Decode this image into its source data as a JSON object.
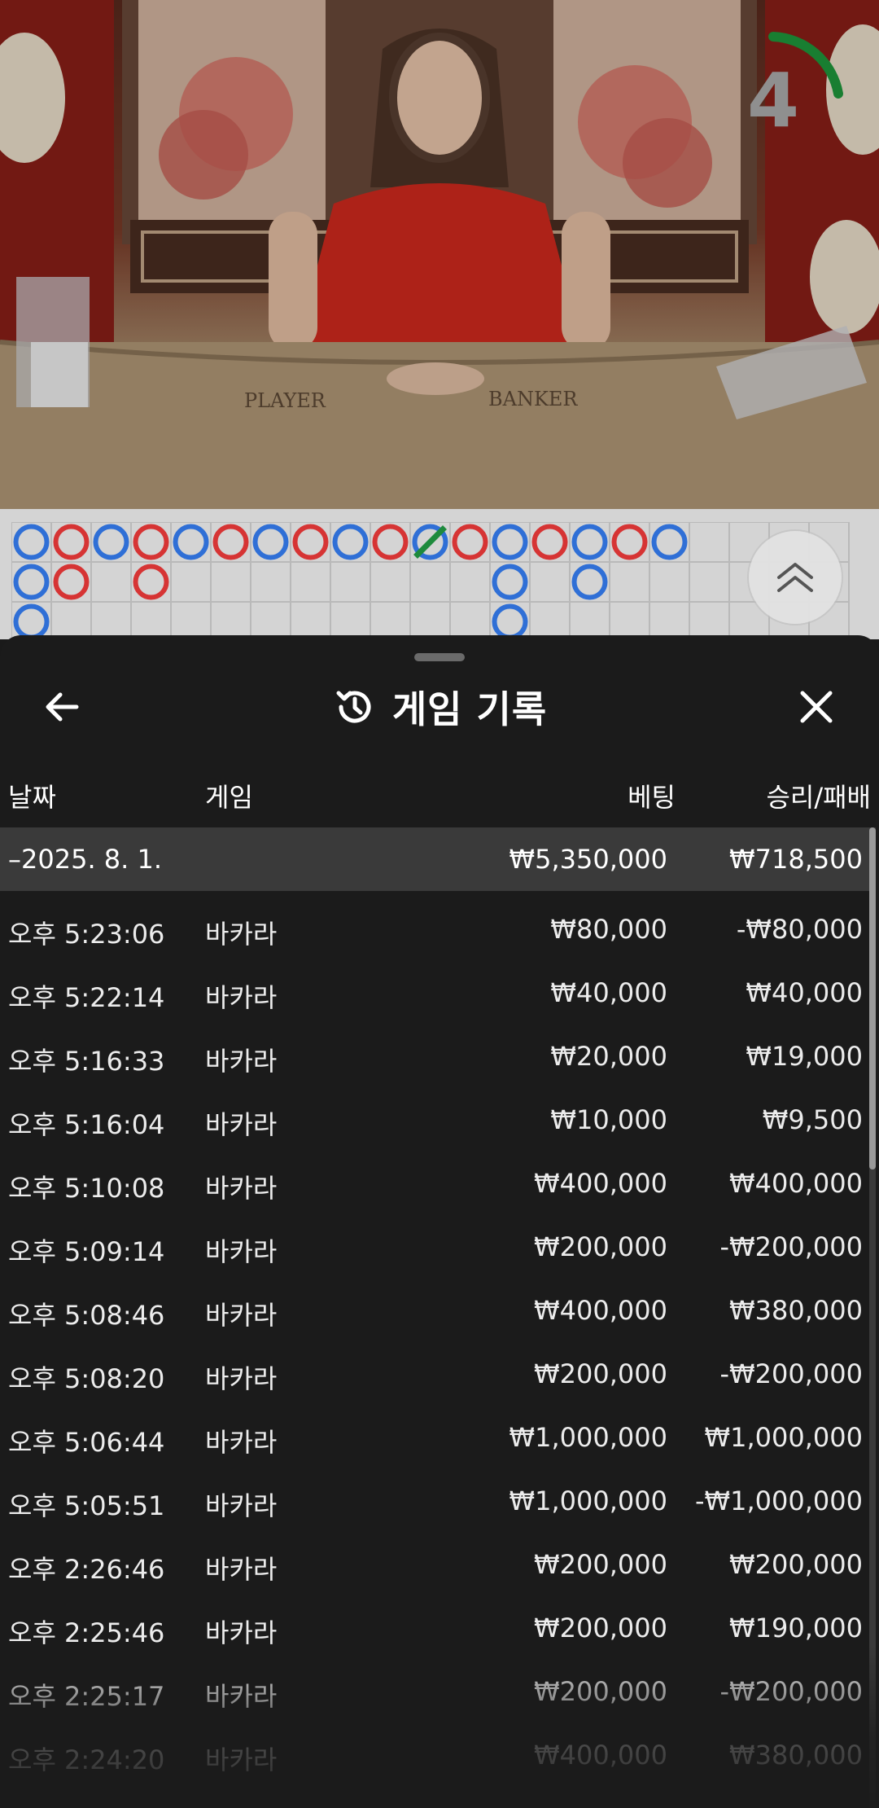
{
  "video": {
    "countdown": "4",
    "table_labels": {
      "player": "PLAYER",
      "banker": "BANKER"
    }
  },
  "roadmap": {
    "colors": {
      "player": "#2f6fd6",
      "banker": "#d63434",
      "tie": "#1e8a3c"
    },
    "columns": [
      [
        "P",
        "P",
        "P"
      ],
      [
        "B",
        "B"
      ],
      [
        "P"
      ],
      [
        "B",
        "B"
      ],
      [
        "P"
      ],
      [
        "B"
      ],
      [
        "P"
      ],
      [
        "B"
      ],
      [
        "P"
      ],
      [
        "B"
      ],
      [
        "P-tie"
      ],
      [
        "B"
      ],
      [
        "P",
        "P",
        "P"
      ],
      [
        "B"
      ],
      [
        "P",
        "P"
      ],
      [
        "B"
      ],
      [
        "P"
      ]
    ]
  },
  "sheet": {
    "title": "게임 기록",
    "icons": {
      "back": "arrow-left-icon",
      "history": "history-icon",
      "close": "close-icon"
    },
    "headers": {
      "date": "날짜",
      "game": "게임",
      "bet": "베팅",
      "win": "승리/패배"
    },
    "summary": {
      "date": "–2025. 8. 1.",
      "bet": "₩5,350,000",
      "win": "₩718,500"
    },
    "rows": [
      {
        "time": "오후 5:23:06",
        "game": "바카라",
        "bet": "₩80,000",
        "win": "-₩80,000"
      },
      {
        "time": "오후 5:22:14",
        "game": "바카라",
        "bet": "₩40,000",
        "win": "₩40,000"
      },
      {
        "time": "오후 5:16:33",
        "game": "바카라",
        "bet": "₩20,000",
        "win": "₩19,000"
      },
      {
        "time": "오후 5:16:04",
        "game": "바카라",
        "bet": "₩10,000",
        "win": "₩9,500"
      },
      {
        "time": "오후 5:10:08",
        "game": "바카라",
        "bet": "₩400,000",
        "win": "₩400,000"
      },
      {
        "time": "오후 5:09:14",
        "game": "바카라",
        "bet": "₩200,000",
        "win": "-₩200,000"
      },
      {
        "time": "오후 5:08:46",
        "game": "바카라",
        "bet": "₩400,000",
        "win": "₩380,000"
      },
      {
        "time": "오후 5:08:20",
        "game": "바카라",
        "bet": "₩200,000",
        "win": "-₩200,000"
      },
      {
        "time": "오후 5:06:44",
        "game": "바카라",
        "bet": "₩1,000,000",
        "win": "₩1,000,000"
      },
      {
        "time": "오후 5:05:51",
        "game": "바카라",
        "bet": "₩1,000,000",
        "win": "-₩1,000,000"
      },
      {
        "time": "오후 2:26:46",
        "game": "바카라",
        "bet": "₩200,000",
        "win": "₩200,000"
      },
      {
        "time": "오후 2:25:46",
        "game": "바카라",
        "bet": "₩200,000",
        "win": "₩190,000"
      },
      {
        "time": "오후 2:25:17",
        "game": "바카라",
        "bet": "₩200,000",
        "win": "-₩200,000"
      },
      {
        "time": "오후 2:24:20",
        "game": "바카라",
        "bet": "₩400,000",
        "win": "₩380,000"
      }
    ]
  }
}
